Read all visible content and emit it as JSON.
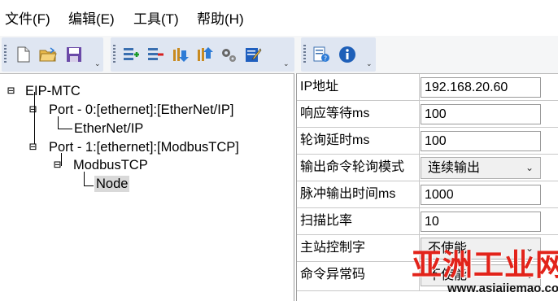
{
  "menu": {
    "file": "文件(F)",
    "edit": "编辑(E)",
    "tools": "工具(T)",
    "help": "帮助(H)"
  },
  "toolbar": {
    "group1": [
      "new-file-icon",
      "open-folder-icon",
      "save-icon"
    ],
    "group2": [
      "add-device-icon",
      "remove-device-icon",
      "download-icon",
      "upload-icon",
      "settings-gears-icon",
      "edit-icon"
    ],
    "group3": [
      "log-window-icon",
      "info-icon"
    ],
    "dropdown_glyph": "⌄"
  },
  "tree": {
    "root": "EIP-MTC",
    "port0": "Port - 0:[ethernet]:[EtherNet/IP]",
    "ethernetip": "EtherNet/IP",
    "port1": "Port - 1:[ethernet]:[ModbusTCP]",
    "modbustcp": "ModbusTCP",
    "node": "Node"
  },
  "properties": [
    {
      "label": "IP地址",
      "value": "192.168.20.60",
      "type": "text"
    },
    {
      "label": "响应等待ms",
      "value": "100",
      "type": "text"
    },
    {
      "label": "轮询延时ms",
      "value": "100",
      "type": "text"
    },
    {
      "label": "输出命令轮询模式",
      "value": "连续输出",
      "type": "select"
    },
    {
      "label": "脉冲输出时间ms",
      "value": "1000",
      "type": "text"
    },
    {
      "label": "扫描比率",
      "value": "10",
      "type": "text"
    },
    {
      "label": "主站控制字",
      "value": "不使能",
      "type": "select"
    },
    {
      "label": "命令异常码",
      "value": "不使能",
      "type": "select"
    }
  ],
  "watermark": {
    "title": "亚洲工业网",
    "url": "www.asiaiiemao.com"
  },
  "colors": {
    "toolbar_group_bg": "#dfe6f2",
    "selection_bg": "#d9d9d9",
    "watermark_red": "#e2231a"
  }
}
